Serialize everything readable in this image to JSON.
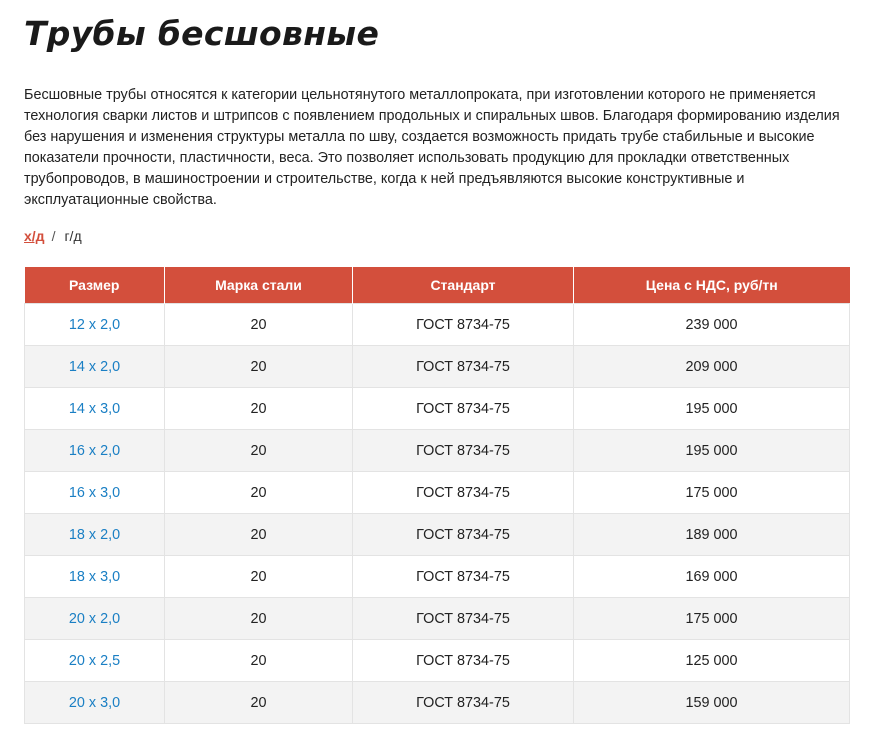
{
  "title": "Трубы бесшовные",
  "description": "Бесшовные трубы относятся к категории цельнотянутого металлопроката, при изготовлении которого не применяется технология сварки листов и штрипсов с появлением продольных и спиральных швов. Благодаря формированию изделия без нарушения и изменения структуры металла по шву, создается возможность придать трубе стабильные и высокие показатели прочности, пластичности, веса. Это позволяет использовать продукцию для прокладки ответственных трубопроводов, в машиностроении и строительстве, когда к ней предъявляются высокие конструктивные и эксплуатационные свойства.",
  "switcher": {
    "active": "х/д",
    "separator": "/",
    "other": "г/д"
  },
  "table": {
    "headers": [
      "Размер",
      "Марка стали",
      "Стандарт",
      "Цена с НДС, руб/тн"
    ],
    "rows": [
      [
        "12 x 2,0",
        "20",
        "ГОСТ 8734-75",
        "239 000"
      ],
      [
        "14 x 2,0",
        "20",
        "ГОСТ 8734-75",
        "209 000"
      ],
      [
        "14 x 3,0",
        "20",
        "ГОСТ 8734-75",
        "195 000"
      ],
      [
        "16 x 2,0",
        "20",
        "ГОСТ 8734-75",
        "195 000"
      ],
      [
        "16 x 3,0",
        "20",
        "ГОСТ 8734-75",
        "175 000"
      ],
      [
        "18 x 2,0",
        "20",
        "ГОСТ 8734-75",
        "189 000"
      ],
      [
        "18 x 3,0",
        "20",
        "ГОСТ 8734-75",
        "169 000"
      ],
      [
        "20 x 2,0",
        "20",
        "ГОСТ 8734-75",
        "175 000"
      ],
      [
        "20 x 2,5",
        "20",
        "ГОСТ 8734-75",
        "125 000"
      ],
      [
        "20 x 3,0",
        "20",
        "ГОСТ 8734-75",
        "159 000"
      ]
    ]
  },
  "colors": {
    "accent": "#d34f3c",
    "link": "#1a7fc4",
    "row_alt": "#f3f3f3"
  }
}
